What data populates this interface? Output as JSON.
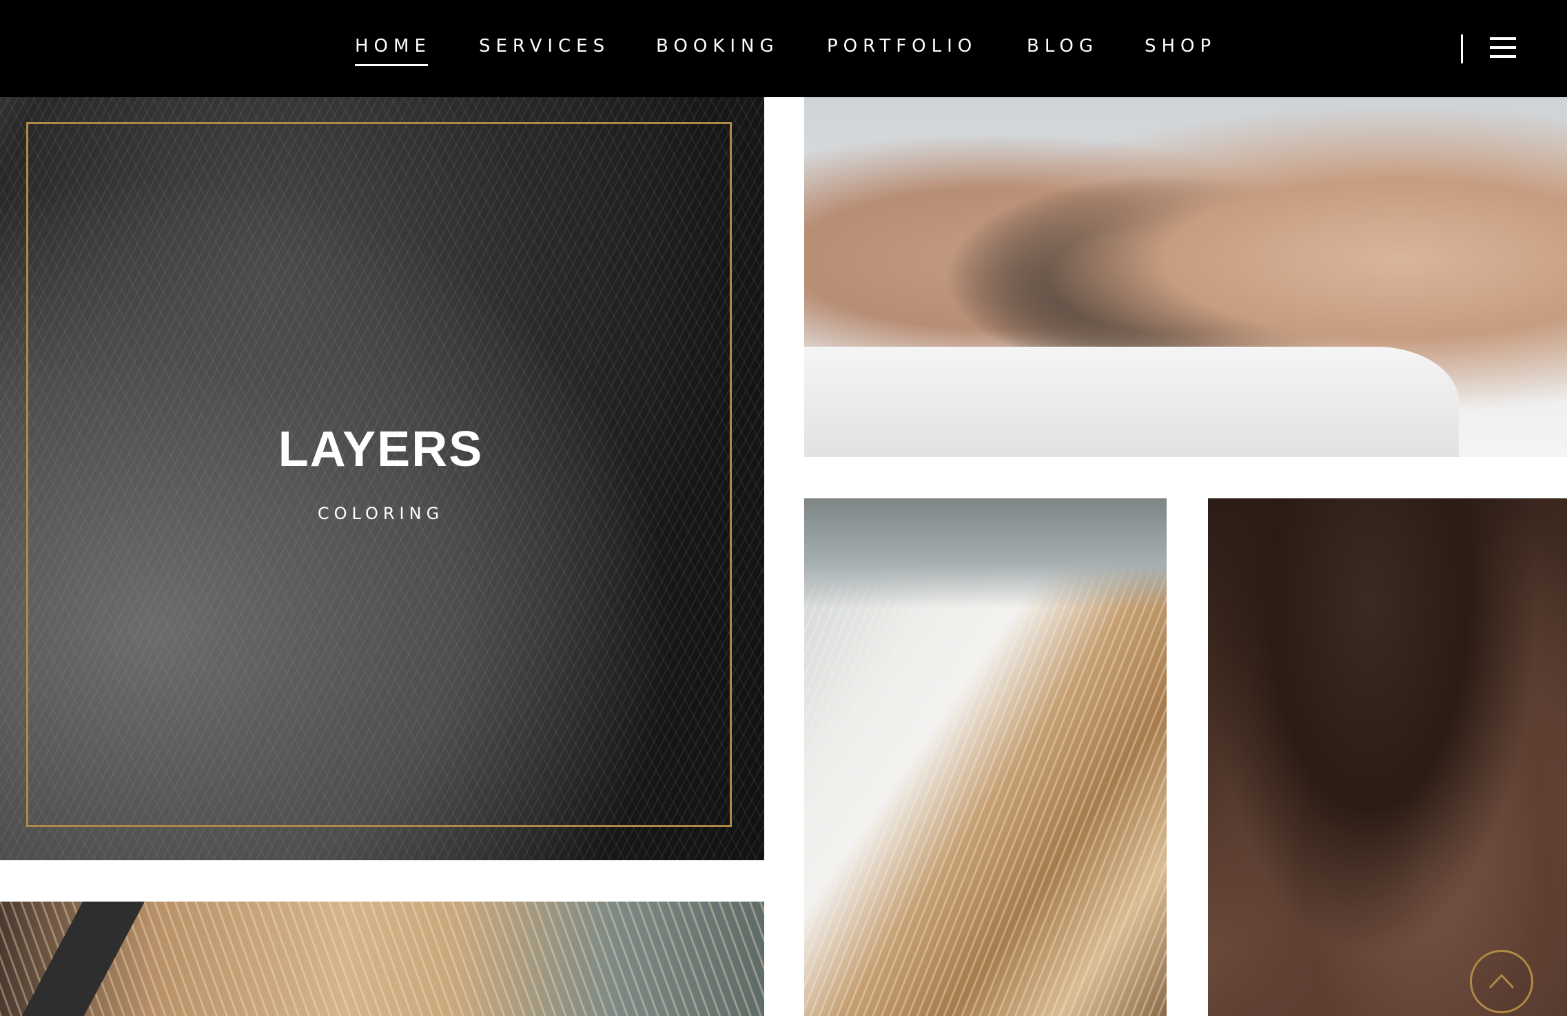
{
  "nav": {
    "items": [
      {
        "label": "HOME",
        "active": true
      },
      {
        "label": "SERVICES",
        "active": false
      },
      {
        "label": "BOOKING",
        "active": false
      },
      {
        "label": "PORTFOLIO",
        "active": false
      },
      {
        "label": "BLOG",
        "active": false
      },
      {
        "label": "SHOP",
        "active": false
      }
    ]
  },
  "header": {
    "menu_icon": "hamburger-menu-icon"
  },
  "featured_tile": {
    "title": "LAYERS",
    "category": "COLORING"
  },
  "scroll_top": {
    "icon": "chevron-up-icon"
  },
  "colors": {
    "header_bg": "#000000",
    "accent_gold": "#b08a45",
    "text_light": "#ffffff"
  }
}
